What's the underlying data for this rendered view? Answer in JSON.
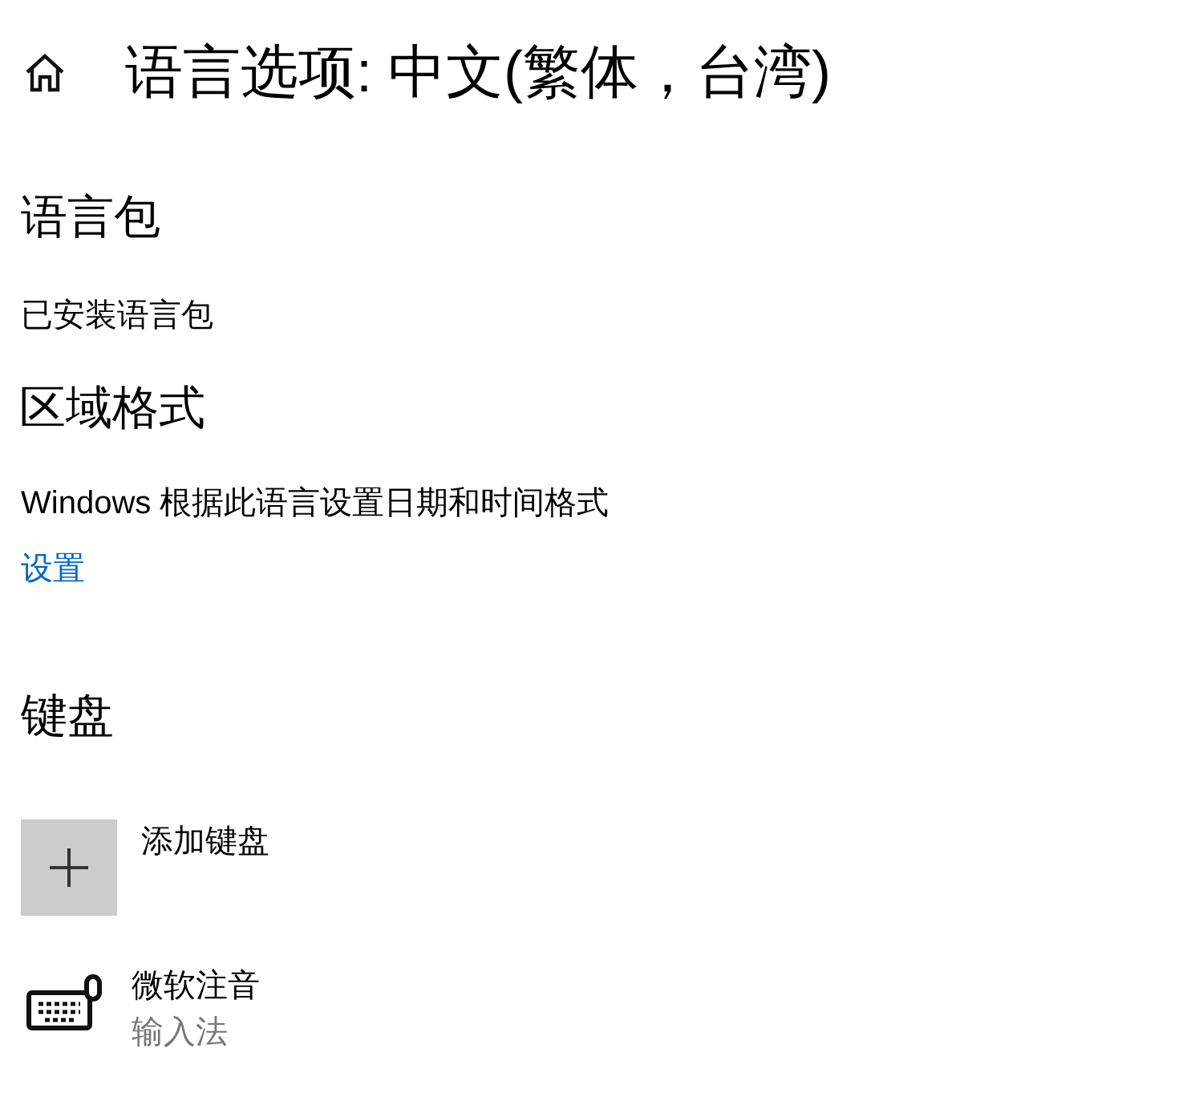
{
  "header": {
    "title": "语言选项: 中文(繁体，台湾)"
  },
  "language_pack": {
    "heading": "语言包",
    "status": "已安装语言包"
  },
  "regional_format": {
    "heading": "区域格式",
    "description": "Windows 根据此语言设置日期和时间格式",
    "link": "设置"
  },
  "keyboard": {
    "heading": "键盘",
    "add_label": "添加键盘",
    "items": [
      {
        "name": "微软注音",
        "subtitle": "输入法"
      }
    ]
  }
}
